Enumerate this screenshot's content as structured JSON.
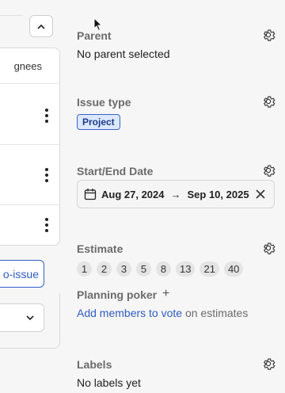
{
  "left": {
    "header_label": "gnees",
    "sub_issue_label": "o-issue"
  },
  "parent": {
    "title": "Parent",
    "value": "No parent selected"
  },
  "issue_type": {
    "title": "Issue type",
    "tag": "Project"
  },
  "dates": {
    "title": "Start/End Date",
    "start": "Aug 27, 2024",
    "arrow": "→",
    "end": "Sep 10, 2025"
  },
  "estimate": {
    "title": "Estimate",
    "options": [
      "1",
      "2",
      "3",
      "5",
      "8",
      "13",
      "21",
      "40"
    ]
  },
  "planning_poker": {
    "title": "Planning poker",
    "plus": "+",
    "link": "Add members to vote",
    "suffix": " on estimates"
  },
  "labels": {
    "title": "Labels",
    "value": "No labels yet"
  },
  "icons": {
    "settings": "gear-icon",
    "calendar": "calendar-icon",
    "clear": "close-icon",
    "collapse": "chevron-up-icon",
    "dropdown": "chevron-down-icon",
    "more": "kebab-icon"
  },
  "colors": {
    "link": "#2f5cc2",
    "tag_bg": "#dbe8ff",
    "tag_border": "#3b63c7"
  }
}
